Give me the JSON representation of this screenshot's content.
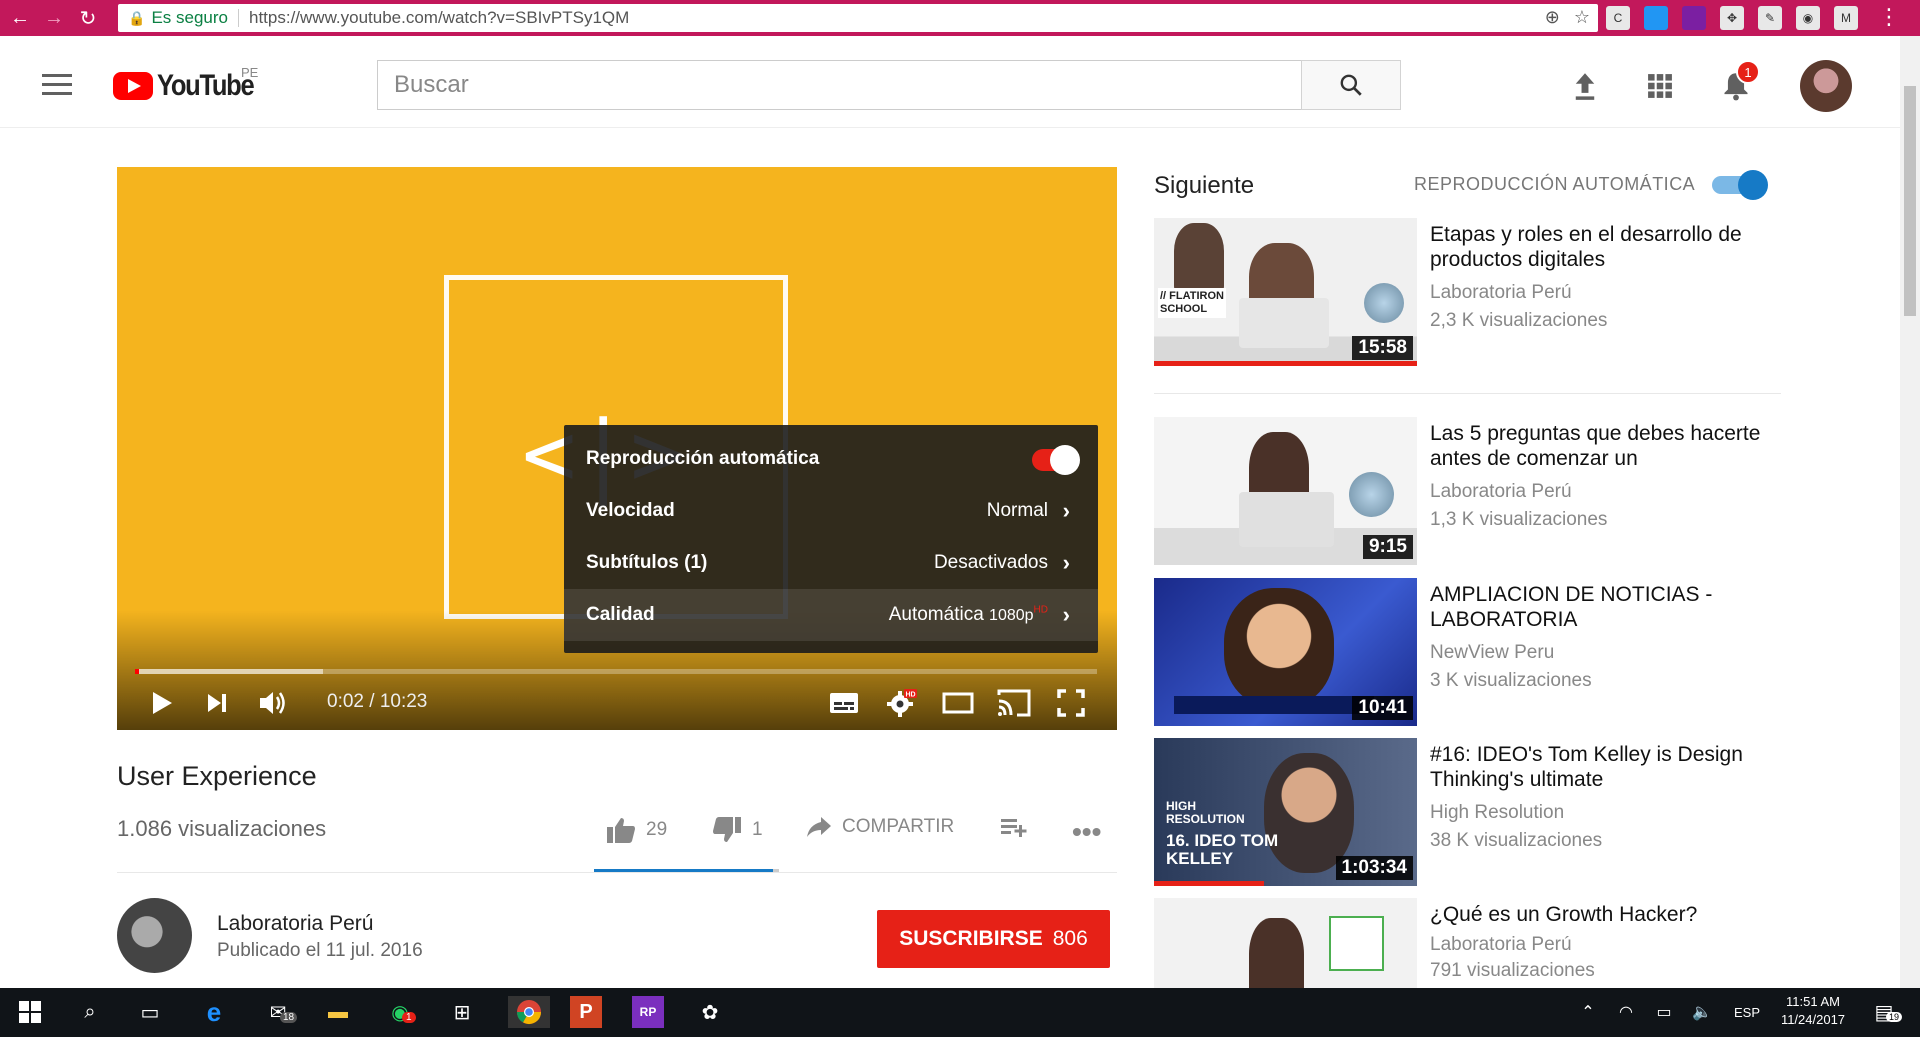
{
  "browser": {
    "secure_label": "Es seguro",
    "url": "https://www.youtube.com/watch?v=SBIvPTSy1QM"
  },
  "header": {
    "logo_text": "YouTube",
    "region": "PE",
    "search_placeholder": "Buscar",
    "notification_count": "1"
  },
  "player": {
    "time": "0:02 / 10:23",
    "progress_played": 0.004,
    "progress_loaded": 0.195,
    "settings": {
      "autoplay_label": "Reproducción automática",
      "speed_label": "Velocidad",
      "speed_value": "Normal",
      "subtitles_label": "Subtítulos (1)",
      "subtitles_value": "Desactivados",
      "quality_label": "Calidad",
      "quality_value": "Automática",
      "quality_res": "1080p",
      "quality_hd": "HD"
    }
  },
  "video": {
    "title": "User Experience",
    "views": "1.086 visualizaciones",
    "likes": "29",
    "dislikes": "1",
    "share_label": "COMPARTIR",
    "like_ratio": 0.967
  },
  "channel": {
    "name": "Laboratoria Perú",
    "published": "Publicado el 11 jul. 2016",
    "subscribe_label": "SUSCRIBIRSE",
    "subscriber_count": "806"
  },
  "sidebar": {
    "up_next": "Siguiente",
    "autoplay": "REPRODUCCIÓN AUTOMÁTICA",
    "items": [
      {
        "title": "Etapas y roles en el desarrollo de productos digitales",
        "channel": "Laboratoria Perú",
        "views": "2,3 K visualizaciones",
        "duration": "15:58",
        "thumb_text": "// FLATIRON SCHOOL"
      },
      {
        "title": "Las 5 preguntas que debes hacerte antes de comenzar un",
        "channel": "Laboratoria Perú",
        "views": "1,3 K visualizaciones",
        "duration": "9:15"
      },
      {
        "title": "AMPLIACION DE NOTICIAS - LABORATORIA",
        "channel": "NewView Peru",
        "views": "3 K visualizaciones",
        "duration": "10:41"
      },
      {
        "title": "#16: IDEO's Tom Kelley is Design Thinking's ultimate",
        "channel": "High Resolution",
        "views": "38 K visualizaciones",
        "duration": "1:03:34",
        "thumb_text": "HIGH RESOLUTION",
        "thumb_text2": "16. IDEO TOM KELLEY"
      },
      {
        "title": "¿Qué es un Growth Hacker?",
        "channel": "Laboratoria Perú",
        "views": "791 visualizaciones",
        "duration": ""
      }
    ]
  },
  "taskbar": {
    "mail_badge": "18",
    "whatsapp_badge": "1",
    "lang": "ESP",
    "time": "11:51 AM",
    "date": "11/24/2017",
    "notif_count": "19"
  }
}
